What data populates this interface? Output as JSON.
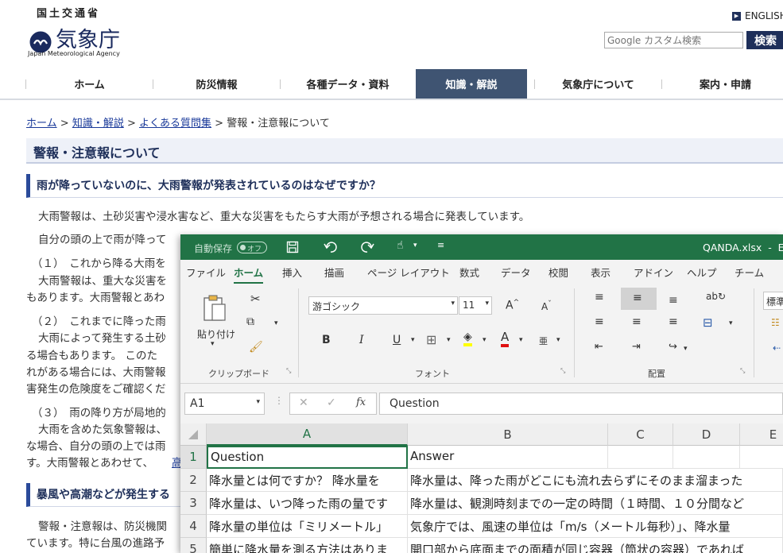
{
  "site": {
    "logo_kanji": "国土交通省",
    "logo_name": "気象庁",
    "logo_en": "Japan Meteorological Agency",
    "english_link": "ENGLISH",
    "search_placeholder": "Google カスタム検索",
    "search_button": "検索"
  },
  "nav": [
    {
      "label": "ホーム"
    },
    {
      "label": "防災情報"
    },
    {
      "label": "各種データ・資料"
    },
    {
      "label": "知識・解説",
      "active": true
    },
    {
      "label": "気象庁について"
    },
    {
      "label": "案内・申請"
    }
  ],
  "breadcrumb": {
    "items": [
      "ホーム",
      "知識・解説",
      "よくある質問集"
    ],
    "sep": ">",
    "current": "警報・注意報について"
  },
  "page_title": "警報・注意報について",
  "questions": [
    {
      "heading": "雨が降っていないのに、大雨警報が発表されているのはなぜですか？"
    },
    {
      "heading": "暴風や高潮などが発生する"
    }
  ],
  "body_lines": [
    "大雨警報は、土砂災害や浸水害など、重大な災害をもたらす大雨が予想される場合に発表しています。",
    "自分の頭の上で雨が降って",
    "（１）　これから降る大雨を",
    "大雨警報は、重大な災害を",
    "もあります。大雨警報とあわ",
    "（２）　これまでに降った雨",
    "大雨によって発生する土砂",
    "る場合もあります。 このた",
    "れがある場合には、大雨警報",
    "害発生の危険度をご確認くだ",
    "（３）　雨の降り方が局地的",
    "大雨を含めた気象警報は、",
    "な場合、自分の頭の上では雨",
    "す。大雨警報とあわせて、",
    "高",
    "警報・注意報は、防災機関",
    "ています。特に台風の進路予"
  ],
  "excel": {
    "autosave_label": "自動保存",
    "autosave_state": "オフ",
    "filename": "QANDA.xlsx",
    "title_suffix": "-",
    "title_cut": "Ex",
    "menu_tabs": [
      "ファイル",
      "ホーム",
      "挿入",
      "描画",
      "ページ レイアウト",
      "数式",
      "データ",
      "校閲",
      "表示",
      "アドイン",
      "ヘルプ",
      "チーム"
    ],
    "active_tab": "ホーム",
    "ribbon": {
      "paste_label": "貼り付け",
      "paste_arrow": "▾",
      "clipboard_group": "クリップボード",
      "font_name": "游ゴシック",
      "font_size": "11",
      "bold": "B",
      "italic": "I",
      "underline": "U",
      "font_group": "フォント",
      "align_group": "配置",
      "number_format": "標準",
      "grow_font": "A",
      "shrink_font": "A",
      "font_color_letter": "A",
      "phonetic_letter": "亜"
    },
    "formula_bar": {
      "name_box": "A1",
      "fx": "fx",
      "cancel": "✕",
      "enter": "✓",
      "content": "Question"
    },
    "columns": [
      "A",
      "B",
      "C",
      "D",
      "E"
    ],
    "rows": [
      {
        "num": "1",
        "a": "Question",
        "b": "Answer"
      },
      {
        "num": "2",
        "a": "降水量とは何ですか？ 降水量を",
        "b": "降水量は、降った雨がどこにも流れ去らずにそのまま溜まった"
      },
      {
        "num": "3",
        "a": "降水量は、いつ降った雨の量です",
        "b": "降水量は、観測時刻までの一定の時間（１時間、１０分間など"
      },
      {
        "num": "4",
        "a": "降水量の単位は「ミリメートル」",
        "b": "気象庁では、風速の単位は「m/s（メートル毎秒）」、降水量"
      },
      {
        "num": "5",
        "a": "簡単に降水量を測る方法はありま",
        "b": "開口部から底面までの面積が同じ容器（筒状の容器）であれば"
      }
    ]
  },
  "colors": {
    "nav_active": "#3f5472",
    "excel_green": "#217346",
    "heading_blue": "#1e2f5a",
    "link_blue": "#1a3a9a"
  }
}
